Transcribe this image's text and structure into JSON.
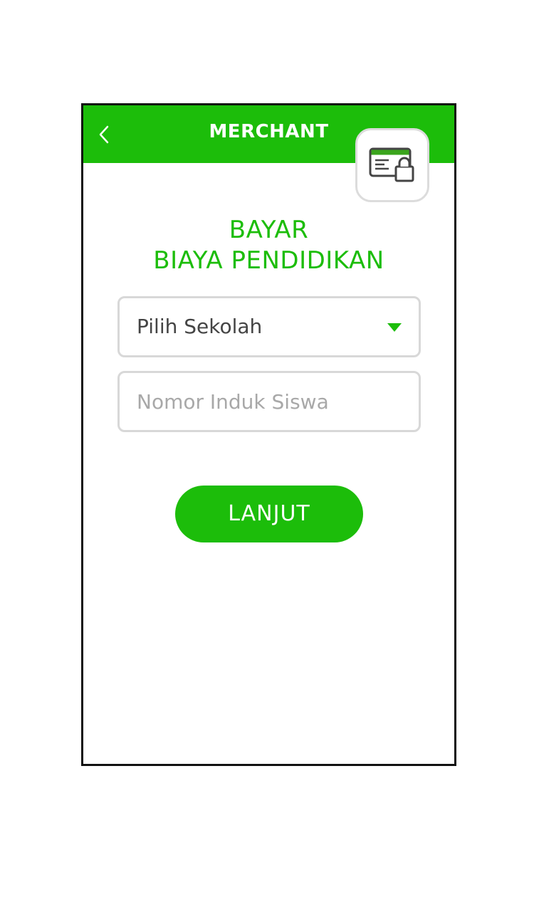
{
  "header": {
    "title": "MERCHANT",
    "back_icon": "chevron-left-icon",
    "action_icon": "secure-card-lock-icon"
  },
  "main": {
    "title_line1": "BAYAR",
    "title_line2": "BIAYA PENDIDIKAN",
    "school_select": {
      "selected": "Pilih Sekolah",
      "icon": "caret-down-icon"
    },
    "student_id_input": {
      "value": "",
      "placeholder": "Nomor Induk Siswa"
    },
    "submit_label": "LANJUT"
  },
  "colors": {
    "brand": "#1cbd0a",
    "border": "#d8d8d8",
    "text": "#444444",
    "placeholder": "#a8a8a8"
  }
}
